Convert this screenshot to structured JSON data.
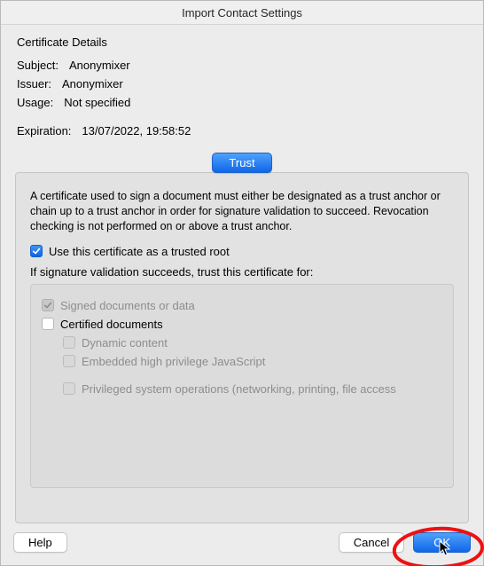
{
  "title": "Import Contact Settings",
  "header": "Certificate Details",
  "subject": {
    "label": "Subject:",
    "value": "Anonymixer"
  },
  "issuer": {
    "label": "Issuer:",
    "value": "Anonymixer"
  },
  "usage": {
    "label": "Usage:",
    "value": "Not specified"
  },
  "expiration": {
    "label": "Expiration:",
    "value": "13/07/2022, 19:58:52"
  },
  "tab": {
    "label": "Trust"
  },
  "panel": {
    "desc": "A certificate used to sign a document must either be designated as a trust anchor or chain up to a trust anchor in order for signature validation to succeed.  Revocation checking is not performed on or above a trust anchor.",
    "use_root": "Use this certificate as a trusted root",
    "if_succeeds": "If signature validation succeeds, trust this certificate for:",
    "opts": {
      "signed": "Signed documents or data",
      "certified": "Certified documents",
      "dynamic": "Dynamic content",
      "embedded": "Embedded high privilege JavaScript",
      "privileged": "Privileged system operations (networking, printing, file access"
    }
  },
  "footer": {
    "help": "Help",
    "cancel": "Cancel",
    "ok": "OK"
  }
}
